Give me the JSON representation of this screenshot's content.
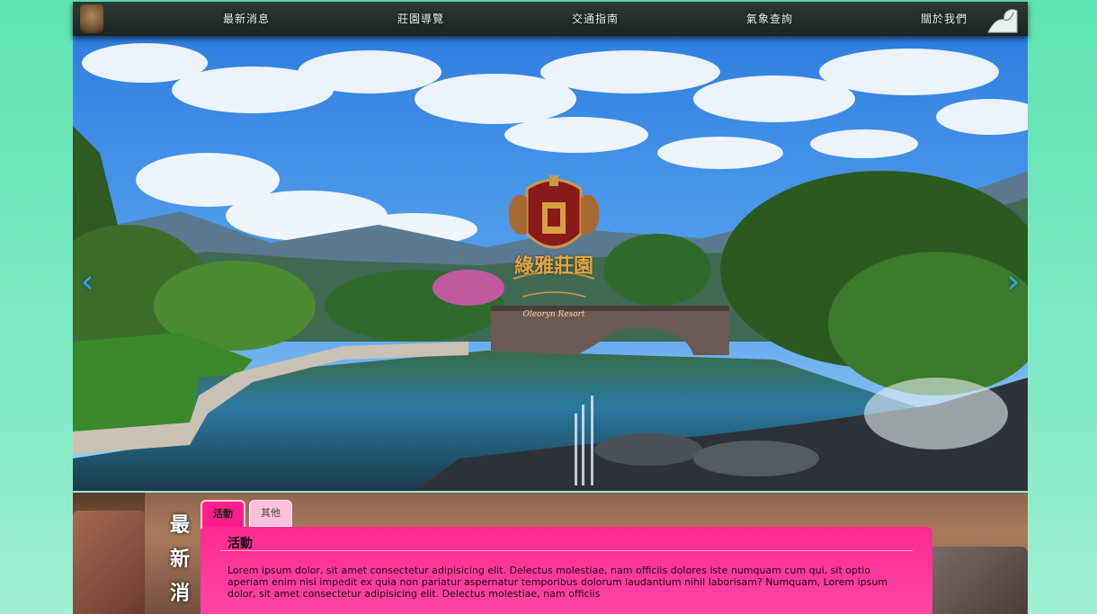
{
  "nav": {
    "items": [
      {
        "label": "最新消息"
      },
      {
        "label": "莊園導覽"
      },
      {
        "label": "交通指南"
      },
      {
        "label": "氣象查詢"
      },
      {
        "label": "關於我們"
      }
    ]
  },
  "hero": {
    "prev_icon": "chevron-left-icon",
    "next_icon": "chevron-right-icon",
    "crest_text": "綠雅莊園",
    "crest_subtext": "Oleoryn Resort",
    "prev_glyph": "‹",
    "next_glyph": "›"
  },
  "news": {
    "title_chars": [
      "最",
      "新",
      "消"
    ],
    "tabs": [
      {
        "label": "活動",
        "active": true
      },
      {
        "label": "其他",
        "active": false
      }
    ],
    "panel": {
      "heading": "活動",
      "body": "Lorem ipsum dolor, sit amet consectetur adipisicing elit. Delectus molestiae, nam officiis dolores iste numquam cum qui, sit optio aperiam enim nisi impedit ex quia non pariatur aspernatur temporibus dolorum laudantium nihil laborisam? Numquam, Lorem ipsum dolor, sit amet consectetur adipisicing elit. Delectus molestiae, nam officiis"
    }
  },
  "colors": {
    "accent_pink": "#ff1d8c",
    "nav_bg": "#1a2422",
    "page_bg": "#5fe3b3",
    "arrow": "#3aa0ff"
  }
}
